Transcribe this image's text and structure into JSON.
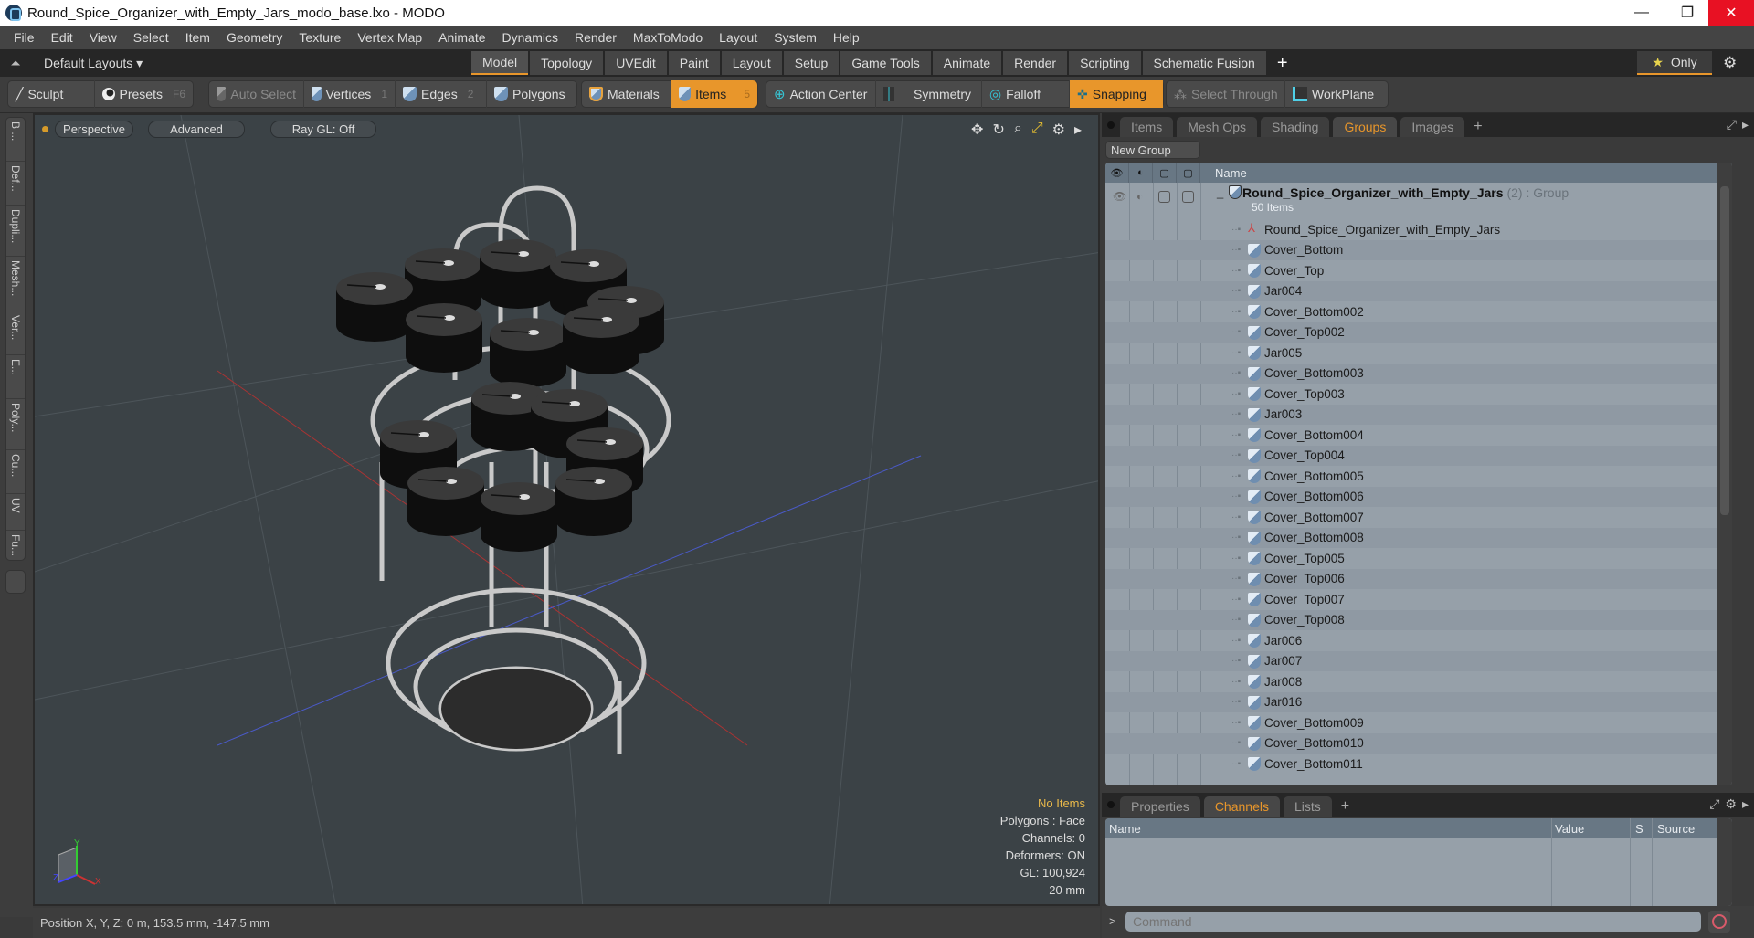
{
  "window": {
    "title": "Round_Spice_Organizer_with_Empty_Jars_modo_base.lxo - MODO",
    "minimize": "—",
    "restore": "❐",
    "close": "✕"
  },
  "menu": [
    "File",
    "Edit",
    "View",
    "Select",
    "Item",
    "Geometry",
    "Texture",
    "Vertex Map",
    "Animate",
    "Dynamics",
    "Render",
    "MaxToModo",
    "Layout",
    "System",
    "Help"
  ],
  "layoutbar": {
    "layouts_label": "Default Layouts ▾",
    "tabs": [
      "Model",
      "Topology",
      "UVEdit",
      "Paint",
      "Layout",
      "Setup",
      "Game Tools",
      "Animate",
      "Render",
      "Scripting",
      "Schematic Fusion"
    ],
    "active_tab": "Model",
    "add": "+",
    "only_label": "Only",
    "star": "★"
  },
  "toolbar": {
    "sculpt": "Sculpt",
    "presets": "Presets",
    "presets_key": "F6",
    "auto_select": "Auto Select",
    "vertices": "Vertices",
    "vertices_key": "1",
    "edges": "Edges",
    "edges_key": "2",
    "polygons": "Polygons",
    "materials": "Materials",
    "items": "Items",
    "items_key": "5",
    "action_center": "Action Center",
    "symmetry": "Symmetry",
    "falloff": "Falloff",
    "snapping": "Snapping",
    "select_through": "Select Through",
    "workplane": "WorkPlane"
  },
  "vertical_tabs": [
    "B ...",
    "Def...",
    "Dupli...",
    "Mesh...",
    "Ver...",
    "E...",
    "Poly...",
    "Cu...",
    "UV",
    "Fu..."
  ],
  "viewport": {
    "view_mode": "Perspective",
    "shading": "Advanced",
    "raygl": "Ray GL: Off",
    "stats": {
      "selection": "No Items",
      "polygons": "Polygons : Face",
      "channels": "Channels: 0",
      "deformers": "Deformers: ON",
      "gl": "GL: 100,924",
      "scale": "20 mm"
    },
    "axis_labels": {
      "x": "X",
      "y": "Y",
      "z": "Z"
    }
  },
  "status": {
    "position": "Position X, Y, Z:   0 m, 153.5 mm, -147.5 mm"
  },
  "groups_panel": {
    "tabs": [
      "Items",
      "Mesh Ops",
      "Shading",
      "Groups",
      "Images"
    ],
    "active_tab": "Groups",
    "new_group": "New Group",
    "header_name": "Name",
    "root": {
      "name": "Round_Spice_Organizer_with_Empty_Jars",
      "count": "(2)",
      "type": ": Group",
      "sub": "50 Items"
    },
    "items": [
      "Round_Spice_Organizer_with_Empty_Jars",
      "Cover_Bottom",
      "Cover_Top",
      "Jar004",
      "Cover_Bottom002",
      "Cover_Top002",
      "Jar005",
      "Cover_Bottom003",
      "Cover_Top003",
      "Jar003",
      "Cover_Bottom004",
      "Cover_Top004",
      "Cover_Bottom005",
      "Cover_Bottom006",
      "Cover_Bottom007",
      "Cover_Bottom008",
      "Cover_Top005",
      "Cover_Top006",
      "Cover_Top007",
      "Cover_Top008",
      "Jar006",
      "Jar007",
      "Jar008",
      "Jar016",
      "Cover_Bottom009",
      "Cover_Bottom010",
      "Cover_Bottom011"
    ]
  },
  "channels_panel": {
    "tabs": [
      "Properties",
      "Channels",
      "Lists"
    ],
    "active_tab": "Channels",
    "columns": [
      "Name",
      "Value",
      "S",
      "Source"
    ]
  },
  "command": {
    "prompt": ">",
    "placeholder": "Command"
  }
}
